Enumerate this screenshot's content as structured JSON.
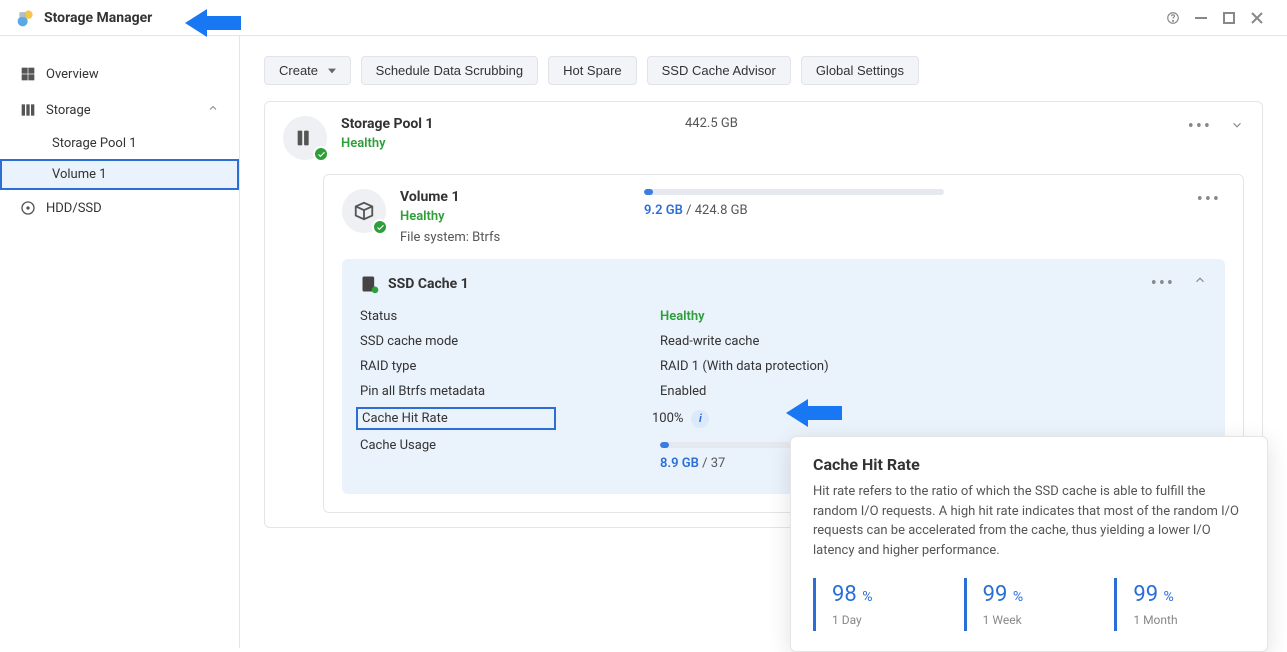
{
  "app": {
    "title": "Storage Manager"
  },
  "sidebar": {
    "overview": "Overview",
    "storage": "Storage",
    "storage_pool": "Storage Pool 1",
    "volume": "Volume 1",
    "hdd_ssd": "HDD/SSD"
  },
  "toolbar": {
    "create": "Create",
    "scrub": "Schedule Data Scrubbing",
    "hotspare": "Hot Spare",
    "advisor": "SSD Cache Advisor",
    "global": "Global Settings"
  },
  "pool": {
    "title": "Storage Pool 1",
    "status": "Healthy",
    "capacity": "442.5 GB"
  },
  "volume": {
    "title": "Volume 1",
    "status": "Healthy",
    "fs": "File system: Btrfs",
    "used": "9.2 GB",
    "total": "424.8 GB",
    "sep": " / "
  },
  "cache": {
    "title": "SSD Cache 1",
    "rows": {
      "status_label": "Status",
      "status_value": "Healthy",
      "mode_label": "SSD cache mode",
      "mode_value": "Read-write cache",
      "raid_label": "RAID type",
      "raid_value": "RAID 1 (With data protection)",
      "pin_label": "Pin all Btrfs metadata",
      "pin_value": "Enabled",
      "hit_label": "Cache Hit Rate",
      "hit_value": "100%",
      "usage_label": "Cache Usage"
    },
    "usage_used": "8.9 GB",
    "usage_sep": " / 37"
  },
  "tooltip": {
    "title": "Cache Hit Rate",
    "body": "Hit rate refers to the ratio of which the SSD cache is able to fulfill the random I/O requests. A high hit rate indicates that most of the random I/O requests can be accelerated from the cache, thus yielding a lower I/O latency and higher performance.",
    "stats": [
      {
        "value": "98",
        "unit": "%",
        "period": "1 Day"
      },
      {
        "value": "99",
        "unit": "%",
        "period": "1 Week"
      },
      {
        "value": "99",
        "unit": "%",
        "period": "1 Month"
      }
    ]
  }
}
